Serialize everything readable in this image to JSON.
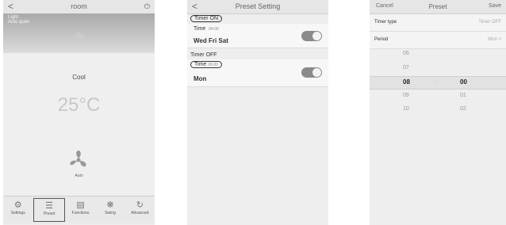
{
  "p1": {
    "back": "<",
    "title": "room",
    "power": "⏻",
    "light": "Light",
    "auto_quiet": "Auto quiet",
    "mode": "Cool",
    "temp": "25°C",
    "fan": "Auto",
    "tabs": [
      {
        "label": "Settings",
        "icon": "⚙"
      },
      {
        "label": "Preset",
        "icon": "☰"
      },
      {
        "label": "Functions",
        "icon": "▤"
      },
      {
        "label": "Swing",
        "icon": "❋"
      },
      {
        "label": "Advanced",
        "icon": "↻"
      }
    ]
  },
  "p2": {
    "back": "<",
    "title": "Preset Setting",
    "timer_on": "Timer ON",
    "on_time_label": "Time",
    "on_time": "04:00",
    "on_days": "Wed Fri Sat",
    "timer_off": "Timer OFF",
    "off_time_label": "Time",
    "off_time": "06:00",
    "off_days": "Mon"
  },
  "p3": {
    "cancel": "Cancel",
    "title": "Preset",
    "save": "Save",
    "timer_type_label": "Timer type",
    "timer_type_value": "Timer OFF",
    "period_label": "Period",
    "period_value": "Mon >",
    "hours": [
      "06",
      "07",
      "08",
      "09",
      "10"
    ],
    "sep": ":",
    "minutes": [
      "00",
      "01",
      "02"
    ]
  }
}
